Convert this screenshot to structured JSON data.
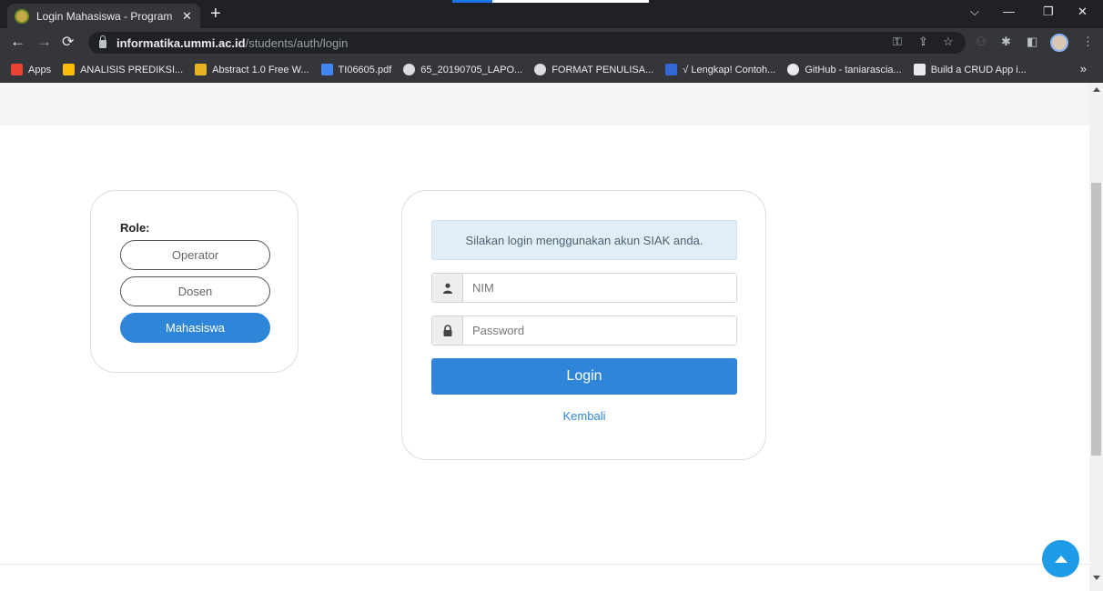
{
  "browser": {
    "tab_title": "Login Mahasiswa - Program Studi",
    "tab_close": "✕",
    "new_tab": "+",
    "url_host": "informatika.ummi.ac.id",
    "url_path": "/students/auth/login",
    "bookmarks": [
      {
        "label": "Apps",
        "color": "#ea4335"
      },
      {
        "label": "ANALISIS PREDIKSI...",
        "color": "#fbbc04"
      },
      {
        "label": "Abstract 1.0 Free W...",
        "color": "#e6b422"
      },
      {
        "label": "TI06605.pdf",
        "color": "#4285f4"
      },
      {
        "label": "65_20190705_LAPO...",
        "color": "#dadce0"
      },
      {
        "label": "FORMAT PENULISA...",
        "color": "#dadce0"
      },
      {
        "label": "√ Lengkap! Contoh...",
        "color": "#3367d6"
      },
      {
        "label": "GitHub - taniarascia...",
        "color": "#e8eaed"
      },
      {
        "label": "Build a CRUD App i...",
        "color": "#e8eaed"
      }
    ],
    "bookmarks_more": "»"
  },
  "role_panel": {
    "label": "Role:",
    "options": [
      "Operator",
      "Dosen",
      "Mahasiswa"
    ],
    "active": "Mahasiswa"
  },
  "login": {
    "info": "Silakan login menggunakan akun SIAK anda.",
    "nim_placeholder": "NIM",
    "password_placeholder": "Password",
    "submit_label": "Login",
    "back_link": "Kembali"
  },
  "colors": {
    "primary": "#2f86d8",
    "info_bg": "#e1edf7",
    "scroll_top": "#1e9be8"
  }
}
